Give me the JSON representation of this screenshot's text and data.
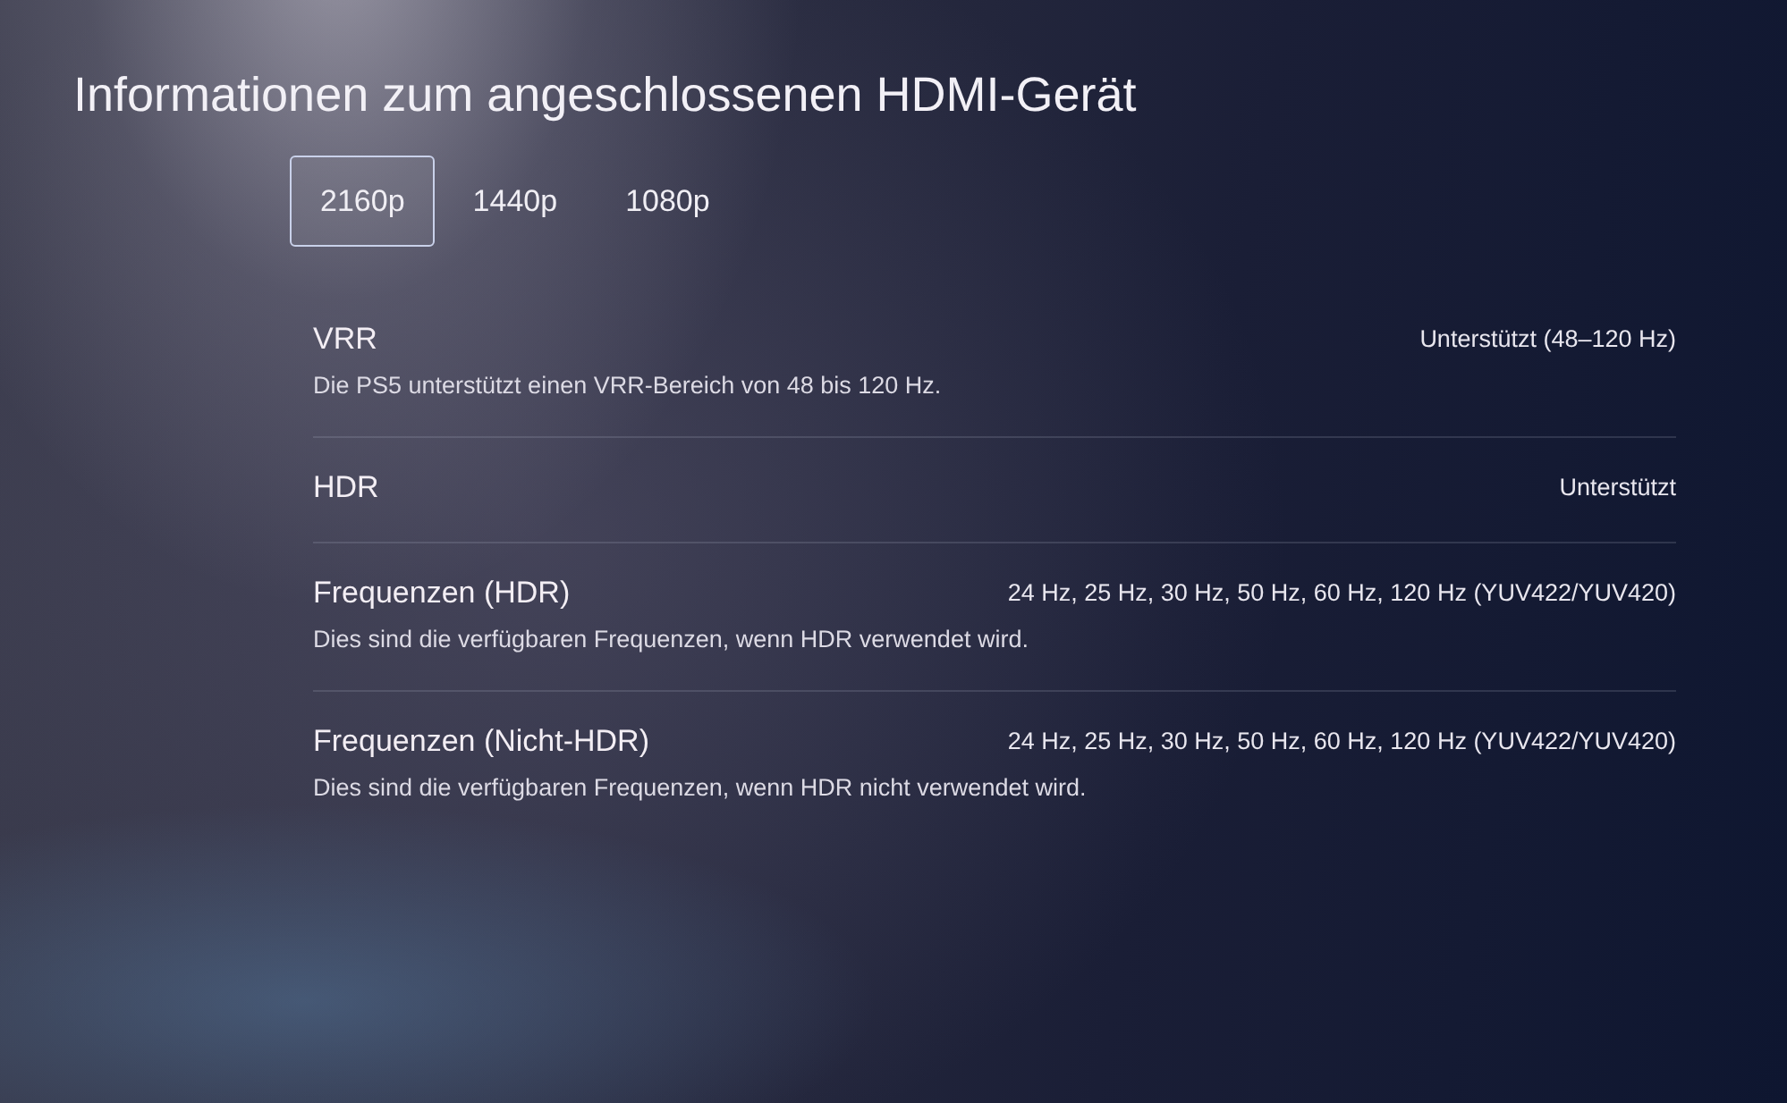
{
  "title": "Informationen zum angeschlossenen HDMI-Gerät",
  "tabs": [
    {
      "label": "2160p",
      "selected": true
    },
    {
      "label": "1440p",
      "selected": false
    },
    {
      "label": "1080p",
      "selected": false
    }
  ],
  "rows": [
    {
      "label": "VRR",
      "value": "Unterstützt (48–120 Hz)",
      "description": "Die PS5 unterstützt einen VRR-Bereich von 48 bis 120 Hz."
    },
    {
      "label": "HDR",
      "value": "Unterstützt"
    },
    {
      "label": "Frequenzen (HDR)",
      "value": "24 Hz, 25 Hz, 30 Hz, 50 Hz, 60 Hz, 120 Hz (YUV422/YUV420)",
      "description": "Dies sind die verfügbaren Frequenzen, wenn HDR verwendet wird."
    },
    {
      "label": "Frequenzen (Nicht-HDR)",
      "value": "24 Hz, 25 Hz, 30 Hz, 50 Hz, 60 Hz, 120 Hz (YUV422/YUV420)",
      "description": "Dies sind die verfügbaren Frequenzen, wenn HDR nicht verwendet wird."
    }
  ]
}
